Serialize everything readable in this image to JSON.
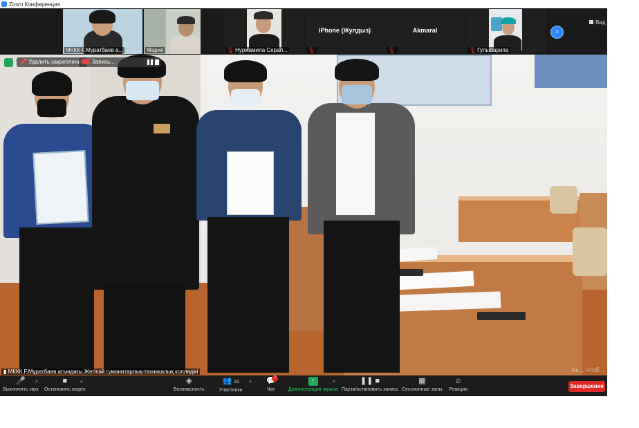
{
  "window": {
    "title": "Zoom Конференция"
  },
  "participants": [
    {
      "name": "МККК F.Муратбаев а...",
      "muted": false,
      "video": true
    },
    {
      "name": "Мария",
      "muted": false,
      "video": true
    },
    {
      "name": "Нуржамила Серал...",
      "muted": true,
      "video": true
    },
    {
      "name": "iPhone (Жулдыз)",
      "muted": true,
      "video": false
    },
    {
      "name": "Akmaral",
      "muted": true,
      "video": false
    },
    {
      "name": "Гульшарипа",
      "muted": true,
      "video": true
    }
  ],
  "strip": {
    "view_label": "Вид",
    "next_icon": "chevron-right-icon"
  },
  "main": {
    "pills": {
      "unpin": "Удалить закрепление",
      "recording": "Запись..."
    },
    "speaker_caption": "МККК F.Мұратбаев атындағы Жетісай гуманитарлық-техникалық колледжі",
    "watermark": "Ак... Чтоб..."
  },
  "toolbar": {
    "mute": "Выключить звук",
    "stop_video": "Остановить видео",
    "security": "Безопасность",
    "participants": "Участники",
    "participants_count": "31",
    "chat": "Чат",
    "chat_badge": "7",
    "share_screen": "Демонстрация экрана",
    "pause_recording": "Пауза/остановить запись",
    "breakout_rooms": "Сессионные залы",
    "reactions": "Реакции",
    "end": "Завершение"
  },
  "colors": {
    "accent": "#2d8cff",
    "end": "#e02828",
    "share": "#23a559"
  }
}
